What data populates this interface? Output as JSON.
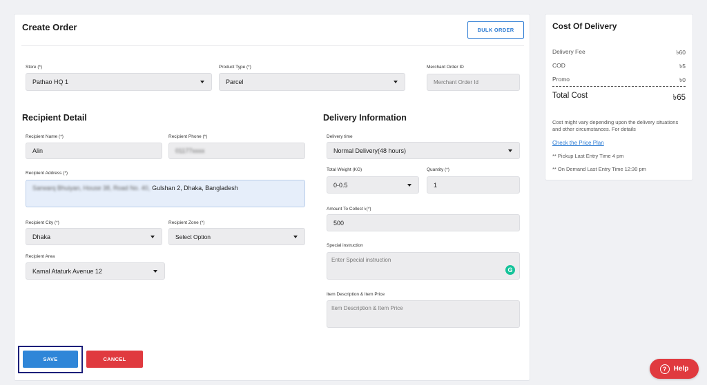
{
  "create_order": {
    "title": "Create Order",
    "bulk_button": "BULK ORDER",
    "store": {
      "label": "Store (*)",
      "value": "Pathao HQ 1"
    },
    "product_type": {
      "label": "Product Type (*)",
      "value": "Parcel"
    },
    "merchant_order_id": {
      "label": "Merchant Order ID",
      "placeholder": "Merchant Order Id"
    }
  },
  "recipient": {
    "title": "Recipient Detail",
    "name": {
      "label": "Recipient Name (*)",
      "value": "Alin"
    },
    "phone": {
      "label": "Recipient Phone (*)",
      "value": "01177xxxx"
    },
    "address": {
      "label": "Recipient Address (*)",
      "value_hidden": "Sarwarq Bhuiyan, House 38, Road No. 40,",
      "value_visible": "Gulshan 2,  Dhaka, Bangladesh"
    },
    "city": {
      "label": "Recipient City (*)",
      "value": "Dhaka"
    },
    "zone": {
      "label": "Recipient Zone (*)",
      "value": "Select Option"
    },
    "area": {
      "label": "Recipient Area",
      "value": "Kamal Ataturk Avenue 12"
    }
  },
  "delivery": {
    "title": "Delivery Information",
    "time": {
      "label": "Delivery time",
      "value": "Normal Delivery(48 hours)"
    },
    "weight": {
      "label": "Total Weight (KG)",
      "value": "0-0.5"
    },
    "quantity": {
      "label": "Quantity (*)",
      "value": "1"
    },
    "amount": {
      "label": "Amount To Collect ৳(*)",
      "value": "500"
    },
    "special": {
      "label": "Special instruction",
      "placeholder": "Enter Special instruction"
    },
    "item_desc": {
      "label": "Item Description & Item Price",
      "placeholder": "Item Description & Item Price"
    }
  },
  "actions": {
    "save": "SAVE",
    "cancel": "CANCEL"
  },
  "cost": {
    "title": "Cost Of Delivery",
    "rows": [
      {
        "label": "Delivery Fee",
        "value": "৳60"
      },
      {
        "label": "COD",
        "value": "৳5"
      },
      {
        "label": "Promo",
        "value": "৳0"
      }
    ],
    "total_label": "Total Cost",
    "total_value": "৳65",
    "note": "Cost might vary depending upon the delivery situations and other circumstances. For details",
    "price_plan_link": "Check the Price Plan",
    "pickup_note": "** Pickup Last Entry Time 4 pm",
    "on_demand_note": "** On Demand Last Entry Time 12:30 pm"
  },
  "help": {
    "label": "Help",
    "icon": "question-circle-icon"
  },
  "grammarly_icon": "G"
}
